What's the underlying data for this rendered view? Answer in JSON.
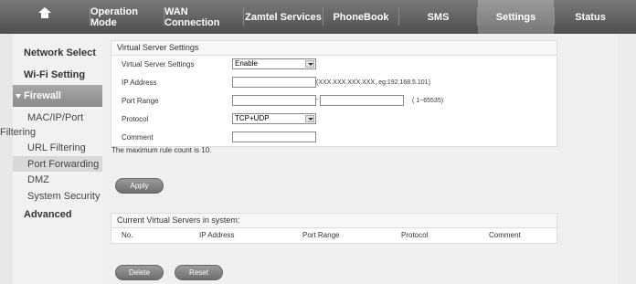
{
  "nav": {
    "home_icon": "home-icon",
    "tabs": [
      "Operation Mode",
      "WAN Connection",
      "Zamtel Services",
      "PhoneBook",
      "SMS",
      "Settings",
      "Status"
    ],
    "selected": "Settings"
  },
  "sidebar": {
    "network_select": "Network Select",
    "wifi": "Wi-Fi Setting",
    "firewall": "Firewall",
    "firewall_items": [
      "MAC/IP/Port",
      "Filtering",
      "URL Filtering",
      "Port Forwarding",
      "DMZ",
      "System Security"
    ],
    "advanced": "Advanced"
  },
  "vs": {
    "title": "Virtual Server Settings",
    "labels": {
      "settings": "Virtual Server Settings",
      "ip": "IP Address",
      "port_range": "Port Range",
      "protocol": "Protocol",
      "comment": "Comment"
    },
    "settings_value": "Enable",
    "protocol_value": "TCP+UDP",
    "ip_hint": "(XXX.XXX.XXX.XXX, eg:192.168.5.101)",
    "port_dash": "-",
    "port_hint": "( 1~65535)",
    "max_rule": "The maximum rule count is 10.",
    "apply": "Apply"
  },
  "current": {
    "title": "Current Virtual Servers in system:",
    "columns": [
      "No.",
      "IP Address",
      "Port Range",
      "Protocol",
      "Comment"
    ],
    "delete": "Delete",
    "reset": "Reset"
  }
}
